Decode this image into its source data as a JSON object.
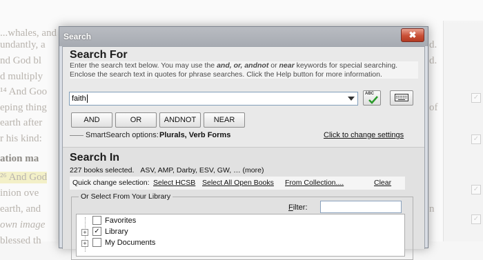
{
  "background_doc": {
    "lines": [
      "...whales, and",
      "undantly, a",
      "nd God bl",
      "d multiply",
      "¹⁴ And Goo",
      "eping thing",
      "earth after",
      "r his kind:",
      "ation ma",
      "²⁶ And God",
      "inion ove",
      "earth, and",
      "own image",
      "blessed th"
    ],
    "right_fragments": [
      "d.",
      "d.",
      "of",
      "n"
    ]
  },
  "dialog": {
    "title": "Search",
    "close_label": "✖",
    "search_for": {
      "heading": "Search For",
      "instr_1": "Enter the search text below. You may use the ",
      "kw_and": "and, or, andnot",
      "instr_2": " or ",
      "kw_near": "near",
      "instr_3": " keywords for special searching. Enclose the search text in quotes for phrase searches. Click the Help button for more information.",
      "query": "faith",
      "spell_icon_text": "ABC",
      "buttons": {
        "and": "AND",
        "or": "OR",
        "andnot": "ANDNOT",
        "near": "NEAR"
      },
      "smart_label": "SmartSearch options:",
      "smart_value": "Plurals, Verb Forms",
      "change_link": "Click to change settings"
    },
    "search_in": {
      "heading": "Search In",
      "selected_count": "227 books selected.",
      "selected_list": "ASV, AMP, Darby, ESV, GW, … (more)",
      "quick_label": "Quick change selection:",
      "links": {
        "select_hcsb": "Select HCSB",
        "select_all": "Select All Open Books",
        "from_collection": "From Collection....",
        "clear": "Clear"
      },
      "library_group": "Or Select From Your Library",
      "filter_label": "Filter:",
      "filter_value": "",
      "tree": [
        {
          "label": "Favorites",
          "checked": false
        },
        {
          "label": "Library",
          "checked": true
        },
        {
          "label": "My Documents",
          "checked": false
        }
      ]
    }
  }
}
